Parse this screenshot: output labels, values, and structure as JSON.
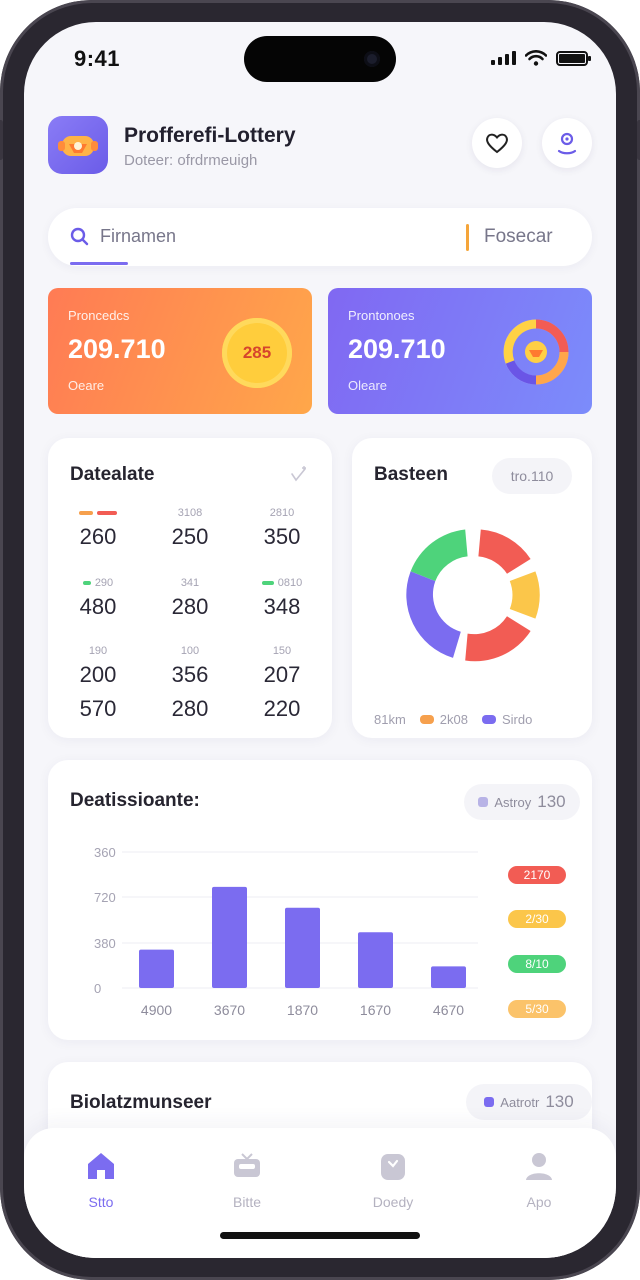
{
  "status_bar": {
    "time": "9:41"
  },
  "header": {
    "title": "Profferefi-Lottery",
    "subtitle": "Doteer: ofrdrmeuigh",
    "icons": [
      "heart-icon",
      "profile-icon"
    ]
  },
  "search": {
    "placeholder": "Firnamen",
    "filter_label": "Fosecar"
  },
  "stat_cards": [
    {
      "label": "Proncedcs",
      "value": "209.710",
      "sub": "Oeare",
      "badge": "285",
      "color": "#ff8a4c"
    },
    {
      "label": "Prontonoes",
      "value": "209.710",
      "sub": "Oleare",
      "color": "#7f6cf3"
    }
  ],
  "grid_panel": {
    "title": "Datealate",
    "rows": [
      [
        {
          "cap": "",
          "num": "260"
        },
        {
          "cap": "3108",
          "num": "250"
        },
        {
          "cap": "2810",
          "num": "350"
        }
      ],
      [
        {
          "cap": "290",
          "num": "480"
        },
        {
          "cap": "341",
          "num": "280"
        },
        {
          "cap": "0810",
          "num": "348"
        }
      ],
      [
        {
          "cap": "190",
          "num": "200",
          "num2": "570"
        },
        {
          "cap": "100",
          "num": "356",
          "num2": "280"
        },
        {
          "cap": "150",
          "num": "207",
          "num2": "220"
        }
      ]
    ]
  },
  "donut_panel": {
    "title": "Basteen",
    "badge": "tro.110",
    "legend": [
      {
        "label": "81km",
        "color": ""
      },
      {
        "label": "2k08",
        "color": "#f6a04d"
      },
      {
        "label": "Sirdo",
        "color": "#7b6cf0"
      }
    ]
  },
  "bar_panel": {
    "title": "Deatissioante:",
    "badge_label": "Astroy",
    "badge_value": "130",
    "chips": [
      {
        "label": "2170",
        "color": "#f25c54"
      },
      {
        "label": "2/30",
        "color": "#fbc64a"
      },
      {
        "label": "8/10",
        "color": "#4ed37b"
      },
      {
        "label": "5/30",
        "color": "#fbc36a"
      }
    ]
  },
  "chart_data": {
    "type": "bar",
    "categories": [
      "4900",
      "3670",
      "1870",
      "1670",
      "4670"
    ],
    "values": [
      110,
      290,
      230,
      160,
      62
    ],
    "ylim": [
      0,
      390
    ],
    "yticks": [
      "0",
      "380",
      "720",
      "360"
    ],
    "color": "#7b6cf0",
    "grid": true
  },
  "list_panel": {
    "title": "Biolatzmunseer",
    "badge_label": "Aatrotr",
    "badge_value": "130"
  },
  "tabbar": {
    "items": [
      {
        "label": "Stto",
        "icon": "home-icon",
        "active": true
      },
      {
        "label": "Bitte",
        "icon": "tv-icon",
        "active": false
      },
      {
        "label": "Doedy",
        "icon": "bag-icon",
        "active": false
      },
      {
        "label": "Apo",
        "icon": "person-icon",
        "active": false
      }
    ]
  },
  "colors": {
    "accent": "#7b6cf0",
    "orange": "#ff8a4c",
    "background": "#f6f6fa"
  }
}
